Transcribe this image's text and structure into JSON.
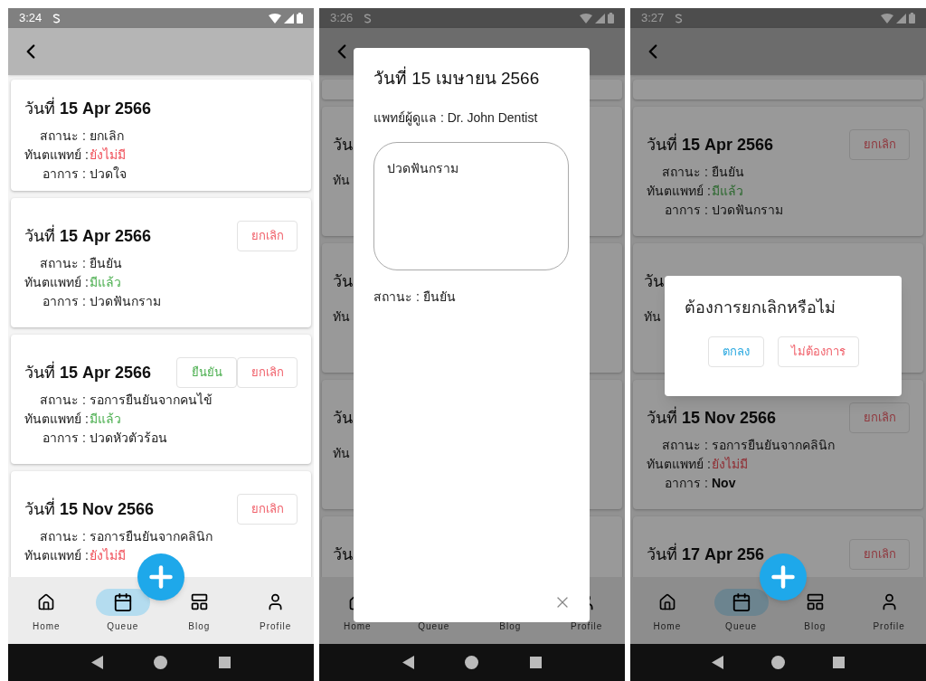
{
  "phones": [
    {
      "time": "3:24",
      "dimmed": false,
      "fab": true,
      "cards": [
        {
          "kind": "full",
          "title": "วันที่ **15 Apr 2566**",
          "fields": [
            {
              "label": "สถานะ :",
              "value": "ยกเลิก",
              "kind": "plain"
            },
            {
              "label": "ทันตแพทย์ :",
              "value": "ยังไม่มี",
              "kind": "bad"
            },
            {
              "label": "อาการ :",
              "value": "ปวดใจ",
              "kind": "plain"
            }
          ]
        },
        {
          "kind": "full",
          "title": "วันที่ **15 Apr 2566**",
          "buttons": [
            {
              "label": "ยกเลิก",
              "kind": "cancel"
            }
          ],
          "fields": [
            {
              "label": "สถานะ :",
              "value": "ยืนยัน",
              "kind": "plain"
            },
            {
              "label": "ทันตแพทย์ :",
              "value": "มีแล้ว",
              "kind": "good"
            },
            {
              "label": "อาการ :",
              "value": "ปวดฟันกราม",
              "kind": "plain"
            }
          ]
        },
        {
          "kind": "full",
          "title": "วันที่ **15 Apr 2566**",
          "buttons": [
            {
              "label": "ยืนยัน",
              "kind": "confirm"
            },
            {
              "label": "ยกเลิก",
              "kind": "cancel"
            }
          ],
          "fields": [
            {
              "label": "สถานะ :",
              "value": "รอการยืนยันจากคนไข้",
              "kind": "plain"
            },
            {
              "label": "ทันตแพทย์ :",
              "value": "มีแล้ว",
              "kind": "good"
            },
            {
              "label": "อาการ :",
              "value": "ปวดหัวตัวร้อน",
              "kind": "plain"
            }
          ]
        },
        {
          "kind": "full",
          "title": "วันที่ **15 Nov 2566**",
          "buttons": [
            {
              "label": "ยกเลิก",
              "kind": "cancel"
            }
          ],
          "fields": [
            {
              "label": "สถานะ :",
              "value": "รอการยืนยันจากคลินิก",
              "kind": "plain"
            },
            {
              "label": "ทันตแพทย์ :",
              "value": "ยังไม่มี",
              "kind": "bad"
            }
          ]
        }
      ],
      "nav": [
        {
          "label": "Home",
          "selected": false
        },
        {
          "label": "Queue",
          "selected": true
        },
        {
          "label": "Blog",
          "selected": false
        },
        {
          "label": "Profile",
          "selected": false
        }
      ]
    },
    {
      "time": "3:26",
      "dimmed": true,
      "fab": false,
      "cards": [
        {
          "kind": "stub"
        },
        {
          "kind": "covered",
          "title": "วัน",
          "fields": [
            {
              "label": "ทัน"
            }
          ]
        },
        {
          "kind": "covered",
          "title": "วัน",
          "fields": [
            {
              "label": "ทัน"
            }
          ]
        },
        {
          "kind": "covered",
          "title": "วัน",
          "fields": [
            {
              "label": "ทัน"
            }
          ]
        },
        {
          "kind": "covered",
          "title": "วัน"
        }
      ],
      "nav": [
        {
          "label": "Home"
        },
        {
          "label": "Queue"
        },
        {
          "label": "Blog"
        },
        {
          "label": "Profile"
        }
      ],
      "modal": {
        "title": "วันที่ 15 เมษายน 2566",
        "doctor": "แพทย์ผู้ดูแล : Dr. John Dentist",
        "symptom": "ปวดฟันกราม",
        "status": "สถานะ : ยืนยัน"
      }
    },
    {
      "time": "3:27",
      "dimmed": true,
      "fab": true,
      "cards": [
        {
          "kind": "stub"
        },
        {
          "kind": "full",
          "title": "วันที่ **15 Apr 2566**",
          "buttons": [
            {
              "label": "ยกเลิก",
              "kind": "cancel"
            }
          ],
          "fields": [
            {
              "label": "สถานะ :",
              "value": "ยืนยัน",
              "kind": "plain"
            },
            {
              "label": "ทันตแพทย์ :",
              "value": "มีแล้ว",
              "kind": "good"
            },
            {
              "label": "อาการ :",
              "value": "ปวดฟันกราม",
              "kind": "plain"
            }
          ]
        },
        {
          "kind": "covered",
          "title": "วัน",
          "fields": [
            {
              "label": "ทัน"
            }
          ]
        },
        {
          "kind": "full",
          "title": "วันที่ **15 Nov 2566**",
          "buttons": [
            {
              "label": "ยกเลิก",
              "kind": "cancel"
            }
          ],
          "fields": [
            {
              "label": "สถานะ :",
              "value": "รอการยืนยันจากคลินิก",
              "kind": "plain"
            },
            {
              "label": "ทันตแพทย์ :",
              "value": "ยังไม่มี",
              "kind": "bad"
            },
            {
              "label": "อาการ :",
              "value": "Nov",
              "kind": "bold"
            }
          ]
        },
        {
          "kind": "full",
          "title": "วันที่ **17 Apr 256**",
          "buttons": [
            {
              "label": "ยกเลิก",
              "kind": "cancel"
            }
          ]
        }
      ],
      "nav": [
        {
          "label": "Home",
          "selected": false
        },
        {
          "label": "Queue",
          "selected": true
        },
        {
          "label": "Blog",
          "selected": false
        },
        {
          "label": "Profile",
          "selected": false
        }
      ],
      "dialog": {
        "question": "ต้องการยกเลิกหรือไม่",
        "buttons": [
          {
            "label": "ตกลง",
            "kind": "ok"
          },
          {
            "label": "ไม่ต้องการ",
            "kind": "cancel"
          }
        ]
      }
    }
  ]
}
